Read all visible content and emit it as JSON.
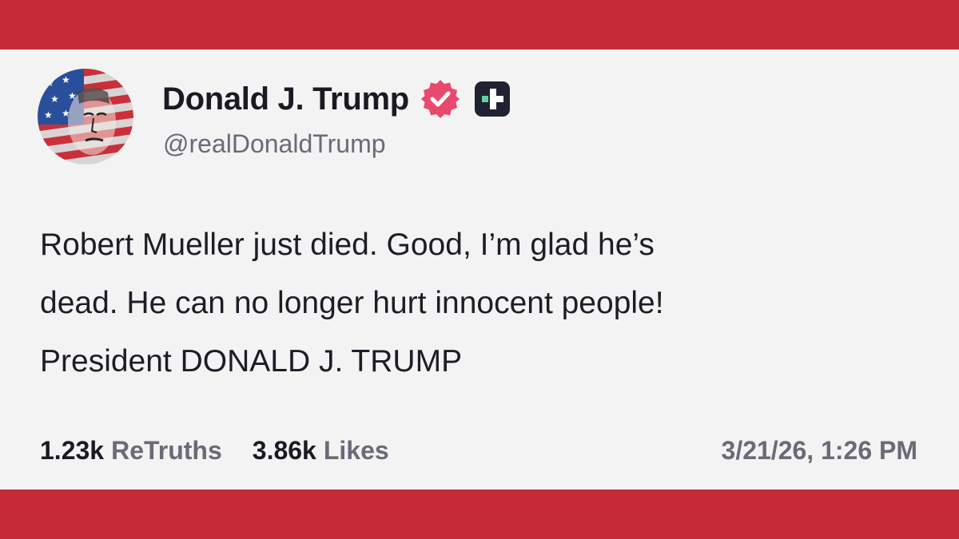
{
  "post": {
    "author": {
      "display_name": "Donald J. Trump",
      "handle": "@realDonaldTrump",
      "avatar_icon": "flag-portrait-avatar",
      "verified_icon": "verified-badge-icon",
      "plus_icon": "plus-badge-icon"
    },
    "body_lines": [
      "Robert Mueller just died. Good, I’m glad he’s",
      "dead. He can no longer hurt innocent people!",
      "President DONALD J. TRUMP"
    ],
    "stats": {
      "retruths_count": "1.23k",
      "retruths_label": "ReTruths",
      "likes_count": "3.86k",
      "likes_label": "Likes"
    },
    "timestamp": "3/21/26, 1:26 PM"
  },
  "colors": {
    "frame_red": "#c62a38",
    "card_background": "#f4f3f3",
    "verified_pink": "#e84a6e",
    "badge_dark": "#1f2230",
    "badge_accent": "#5fd3a0"
  }
}
